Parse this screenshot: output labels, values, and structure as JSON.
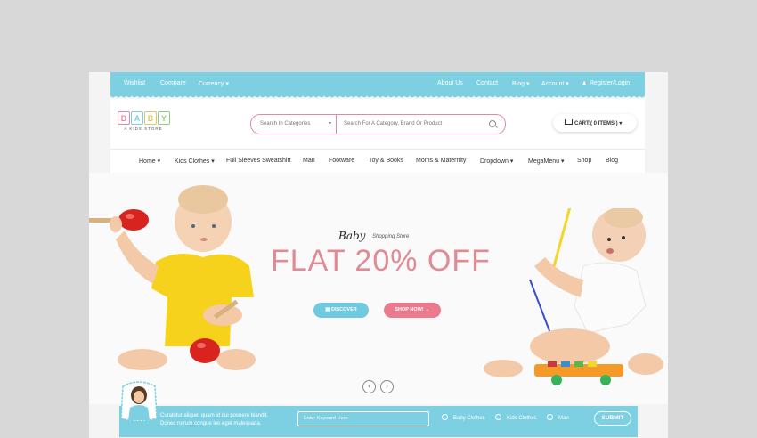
{
  "topbar": {
    "left_links": [
      "Wishlist",
      "Compare",
      "Currency ▾"
    ],
    "right_links": [
      "About Us",
      "Contact",
      "Blog ▾",
      "Account ▾",
      "Register/Login"
    ]
  },
  "logo": {
    "letters": [
      "B",
      "A",
      "B",
      "Y"
    ],
    "tagline": "A KIDS STORE"
  },
  "search": {
    "category": "Search In Categories",
    "placeholder": "Search For A Category, Brand Or Product"
  },
  "cart": {
    "label": "CART:( 0 ITEMS )"
  },
  "nav": {
    "items": [
      "Home ▾",
      "Kids Clothes ▾",
      "Full Sleeves Sweatshirt",
      "Man",
      "Footware",
      "Toy & Books",
      "Moms & Maternity",
      "Dropdown ▾",
      "MegaMenu ▾",
      "Shop",
      "Blog"
    ]
  },
  "hero": {
    "script": "Baby",
    "subtitle": "Shopping Store",
    "headline": "FLAT 20% OFF",
    "discover_label": "DISCOVER",
    "shop_label": "SHOP NOW! →"
  },
  "newsletter": {
    "line1": "Curabitur aliquet quam id dui posuere blandit.",
    "line2": "Donec rutrum congue leo eget malesuada.",
    "keyword_placeholder": "Enter Keyword Here",
    "options": [
      "Baby Clothes",
      "Kids Clothes",
      "Man"
    ],
    "submit_label": "SUBMIT"
  },
  "colors": {
    "accent_blue": "#7dcfe2",
    "accent_pink": "#ec7a8e",
    "headline_pink": "#e08a93"
  }
}
